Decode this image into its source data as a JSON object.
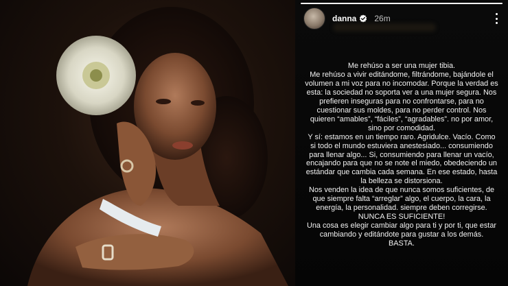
{
  "story": {
    "progress": 1.0,
    "username": "danna",
    "verified": true,
    "time": "26m",
    "icons": {
      "verified": "verified-badge-icon",
      "more": "more-options-icon"
    },
    "paragraphs": [
      "Me rehúso a ser una mujer tibia.",
      "Me rehúso a vivir editándome, filtrándome, bajándole el volumen a mi voz para no incomodar. Porque la verdad es esta: la sociedad no soporta ver a una mujer segura. Nos prefieren inseguras para no confrontarse, para no cuestionar sus moldes, para no perder control. Nos quieren “amables”, “fáciles”, “agradables”. no por amor, sino por comodidad.",
      "Y sí: estamos en un tiempo raro. Agridulce. Vacío. Como si todo el mundo estuviera anestesiado... consumiendo para llenar algo... Si, consumiendo para llenar un vacío, encajando para que no se note el miedo, obedeciendo un estándar que cambia cada semana. En ese estado, hasta la belleza se distorsiona.",
      "Nos venden la idea de que nunca somos suficientes, de que siempre falta “arreglar” algo, el cuerpo, la cara, la energía, la personalidad. siempre deben corregirse.",
      "NUNCA ES SUFICIENTE!",
      "Una cosa es elegir cambiar algo para ti y por ti, que estar cambiando y editándote para gustar a los demás.",
      "BASTA."
    ]
  },
  "colors": {
    "background": "#000000",
    "text": "#f2f2f2",
    "badge": "#ffffff"
  }
}
